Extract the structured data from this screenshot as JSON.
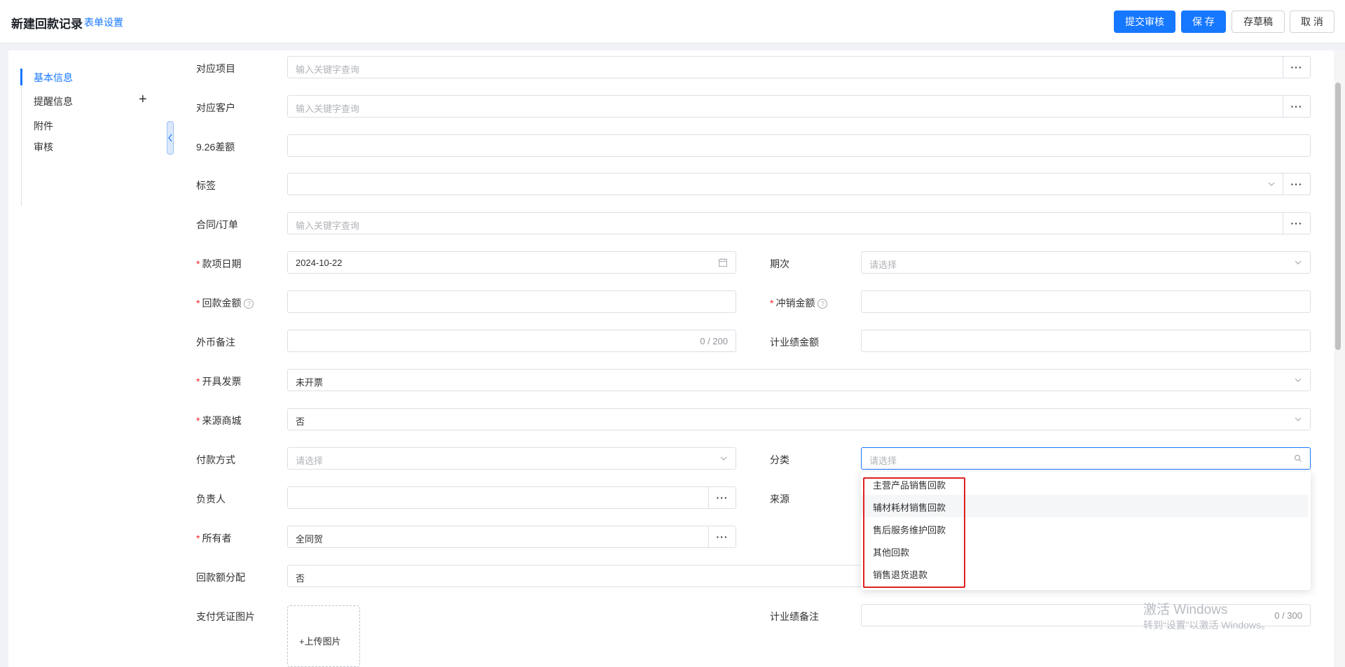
{
  "header": {
    "title": "新建回款记录",
    "settings_link": "表单设置",
    "buttons": {
      "submit": "提交审核",
      "save": "保 存",
      "draft": "存草稿",
      "cancel": "取 消"
    },
    "accent_color": "#1677ff"
  },
  "sidebar": {
    "items": [
      {
        "label": "基本信息"
      },
      {
        "label": "提醒信息"
      },
      {
        "label": "附件"
      },
      {
        "label": "审核"
      }
    ],
    "add_icon": "plus-icon",
    "collapse_icon": "chevron-left-icon"
  },
  "form": {
    "project": {
      "label": "对应项目",
      "placeholder": "输入关键字查询",
      "value": ""
    },
    "customer": {
      "label": "对应客户",
      "placeholder": "输入关键字查询",
      "value": ""
    },
    "diff": {
      "label": "9.26差额",
      "value": ""
    },
    "tags": {
      "label": "标签",
      "value": ""
    },
    "contract": {
      "label": "合同/订单",
      "placeholder": "输入关键字查询",
      "value": ""
    },
    "payment_date": {
      "label": "款项日期",
      "value": "2024-10-22",
      "required": true
    },
    "period": {
      "label": "期次",
      "placeholder": "请选择"
    },
    "amount": {
      "label": "回款金额",
      "value": "",
      "required": true
    },
    "writeoff": {
      "label": "冲销金额",
      "value": "",
      "required": true
    },
    "currency_note": {
      "label": "外币备注",
      "value": "",
      "counter": "0 / 200"
    },
    "perf_amount": {
      "label": "计业绩金额",
      "value": ""
    },
    "invoice": {
      "label": "开具发票",
      "value": "未开票",
      "required": true
    },
    "mall_source": {
      "label": "来源商城",
      "value": "否",
      "required": true
    },
    "pay_method": {
      "label": "付款方式",
      "placeholder": "请选择"
    },
    "category": {
      "label": "分类",
      "placeholder": "请选择"
    },
    "owner_person": {
      "label": "负责人",
      "value": ""
    },
    "source": {
      "label": "来源"
    },
    "owner": {
      "label": "所有者",
      "value": "全同贺",
      "required": true
    },
    "allocation": {
      "label": "回款额分配",
      "value": "否"
    },
    "voucher": {
      "label": "支付凭证图片",
      "upload": "+上传图片"
    },
    "perf_note": {
      "label": "计业绩备注",
      "counter": "0 / 300"
    },
    "help_mark": "?"
  },
  "category_dropdown": {
    "options": [
      "主营产品销售回款",
      "辅材耗材销售回款",
      "售后服务维护回款",
      "其他回款",
      "销售退货退款"
    ],
    "hovered_index": 1
  },
  "watermark": {
    "line1": "激活 Windows",
    "line2": "转到“设置”以激活 Windows。"
  }
}
